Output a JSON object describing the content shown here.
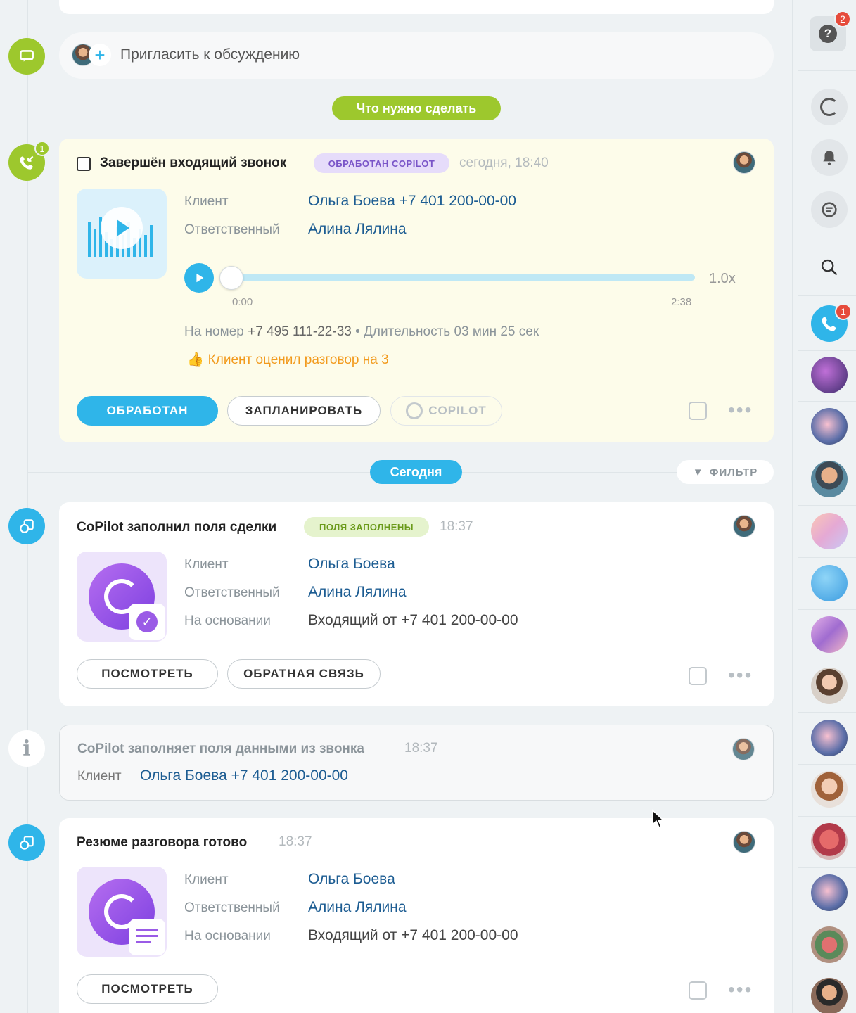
{
  "invite": {
    "text": "Пригласить к обсуждению"
  },
  "section_todo": {
    "label": "Что нужно сделать"
  },
  "section_today": {
    "label": "Сегодня"
  },
  "filter": {
    "label": "ФИЛЬТР"
  },
  "call_card": {
    "badge_count": "1",
    "title": "Завершён входящий звонок",
    "tag": "ОБРАБОТАН COPILOT",
    "time": "сегодня, 18:40",
    "client_label": "Клиент",
    "client_value": "Ольга Боева +7 401 200-00-00",
    "resp_label": "Ответственный",
    "resp_value": "Алина Лялина",
    "player": {
      "speed": "1.0x",
      "time_start": "0:00",
      "time_end": "2:38",
      "progress": 0
    },
    "number_line_prefix": "На номер",
    "number": "+7 495 111-22-33",
    "duration": "Длительность 03 мин 25 сек",
    "rating": "Клиент оценил разговор на 3",
    "btn_done": "ОБРАБОТАН",
    "btn_plan": "ЗАПЛАНИРОВАТЬ",
    "btn_copilot": "COPILOT"
  },
  "copilot_card": {
    "title": "CoPilot заполнил поля сделки",
    "tag": "ПОЛЯ ЗАПОЛНЕНЫ",
    "time": "18:37",
    "client_label": "Клиент",
    "client_value": "Ольга Боева",
    "resp_label": "Ответственный",
    "resp_value": "Алина Лялина",
    "basis_label": "На основании",
    "basis_value": "Входящий от +7 401 200-00-00",
    "btn_view": "ПОСМОТРЕТЬ",
    "btn_feedback": "ОБРАТНАЯ СВЯЗЬ"
  },
  "info_card": {
    "title": "CoPilot заполняет поля данными из звонка",
    "time": "18:37",
    "client_label": "Клиент",
    "client_value": "Ольга Боева +7 401 200-00-00"
  },
  "summary_card": {
    "title": "Резюме разговора готово",
    "time": "18:37",
    "client_label": "Клиент",
    "client_value": "Ольга Боева",
    "resp_label": "Ответственный",
    "resp_value": "Алина Лялина",
    "basis_label": "На основании",
    "basis_value": "Входящий от +7 401 200-00-00",
    "btn_view": "ПОСМОТРЕТЬ"
  },
  "rail": {
    "help_badge": "2",
    "phone_badge": "1"
  },
  "colors": {
    "green": "#9dc82d",
    "blue": "#2fb5e9",
    "link": "#1c5c92",
    "purple_tag": "#e6dcfa",
    "green_tag": "#e5f3cd",
    "rating": "#f29a1d",
    "highlight_bg": "#fdfcea"
  }
}
